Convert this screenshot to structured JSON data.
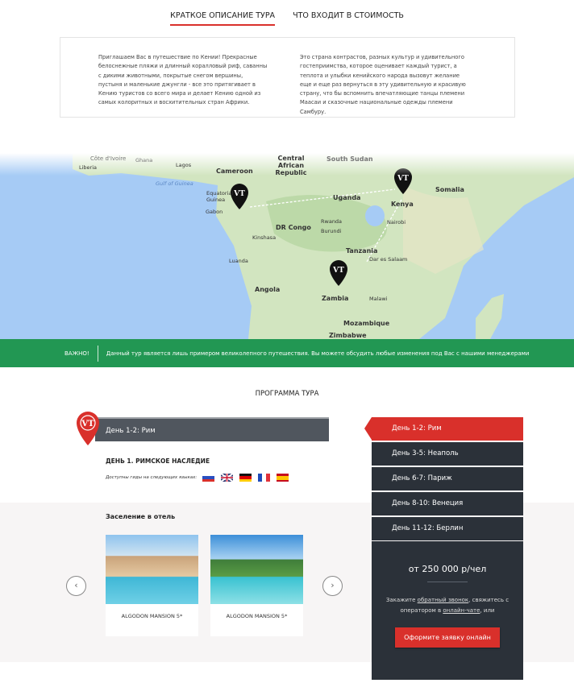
{
  "tabs": [
    {
      "label": "КРАТКОЕ ОПИСАНИЕ ТУРА",
      "active": true
    },
    {
      "label": "ЧТО ВХОДИТ В СТОИМОСТЬ",
      "active": false
    }
  ],
  "description": {
    "col1": "Приглашаем Вас в путешествие по Кении! Прекрасные белоснежные пляжи и длинный коралловый риф, саванны с дикими животными, покрытые снегом вершины, пустыня и маленькие джунгли - все это притягивает в Кению туристов со всего мира и делает Кению одной из самых колоритных и восхитительных стран Африки.",
    "col2": "Это страна контрастов, разных культур и удивительного гостеприимства, которое оценивает каждый турист, а теплота и улыбки кенийского народа вызовут желание еще и еще раз вернуться в эту удивительную и красивую страну, что бы вспомнить впечатляющие танцы племени Маасаи и сказочные национальные одежды племени Самбуру."
  },
  "map": {
    "labels": {
      "cotedivoire": "Côte d'Ivoire",
      "ghana": "Ghana",
      "liberia": "Liberia",
      "lagos": "Lagos",
      "cameroon": "Cameroon",
      "car": "Central African Republic",
      "southsudan": "South Sudan",
      "gulf": "Gulf of Guinea",
      "eqguinea": "Equatorial Guinea",
      "gabon": "Gabon",
      "uganda": "Uganda",
      "kenya": "Kenya",
      "somalia": "Somalia",
      "nairobi": "Nairobi",
      "drcongo": "DR Congo",
      "rwanda": "Rwanda",
      "burundi": "Burundi",
      "kinshasa": "Kinshasa",
      "tanzania": "Tanzania",
      "dar": "Dar es Salaam",
      "luanda": "Luanda",
      "angola": "Angola",
      "zambia": "Zambia",
      "malawi": "Malawi",
      "mozambique": "Mozambique",
      "zimbabwe": "Zimbabwe"
    },
    "pin_logo": "VT"
  },
  "notice": {
    "label": "ВАЖНО!",
    "text": "Данный тур является лишь примером великолепного путешествия. Вы можете обсудить любые изменения под Вас с нашими менеджерами"
  },
  "program": {
    "title": "ПРОГРАММА ТУРА",
    "day_header": "День 1-2: Рим",
    "day_title": "ДЕНЬ 1. РИМСКОЕ НАСЛЕДИЕ",
    "guides_label": "Доступны гиды на следующих языках:",
    "languages": [
      "ru",
      "en",
      "de",
      "fr",
      "es"
    ],
    "hotel_label": "Заселение в отель",
    "hotels": [
      {
        "name": "ALGODON MANSION 5*"
      },
      {
        "name": "ALGODON MANSION 5*"
      }
    ],
    "menu": [
      {
        "label": "День 1-2: Рим",
        "active": true
      },
      {
        "label": "День 3-5: Неаполь"
      },
      {
        "label": "День 6-7: Париж"
      },
      {
        "label": "День 8-10: Венеция"
      },
      {
        "label": "День 11-12: Берлин"
      }
    ]
  },
  "booking": {
    "price": "от 250 000 р/чел",
    "cta_pre": "Закажите ",
    "callback_link": "обратный звонок",
    "cta_mid": ", свяжитесь с оператором в ",
    "chat_link": "онлайн-чате",
    "cta_post": ", или",
    "button": "Оформите заявку онлайн"
  },
  "colors": {
    "accent": "#d9302b",
    "notice": "#229753",
    "dark": "#2b3139"
  }
}
